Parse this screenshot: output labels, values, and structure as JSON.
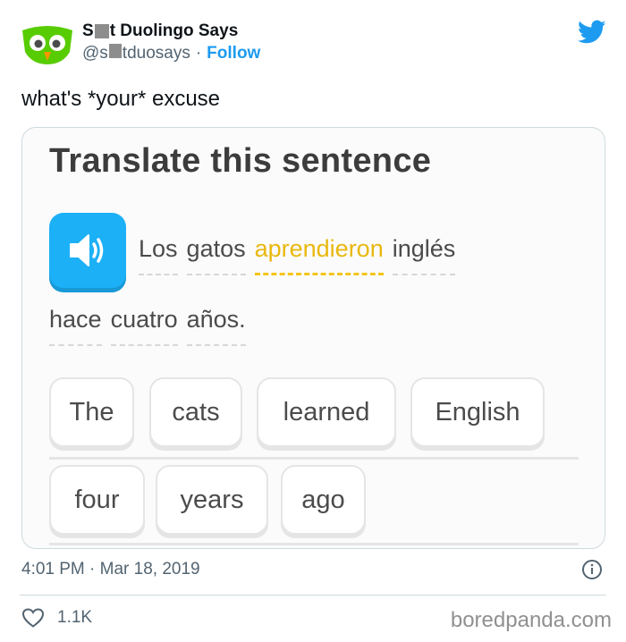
{
  "author": {
    "name_start": "S",
    "name_end": "t Duolingo Says",
    "handle_start": "@s",
    "handle_end": "tduosays",
    "follow_label": "Follow"
  },
  "tweet": {
    "text": "what's *your* excuse",
    "timestamp": "4:01 PM · Mar 18, 2019",
    "likes": "1.1K"
  },
  "card": {
    "title": "Translate this sentence",
    "sentence_words": [
      "Los",
      "gatos",
      "aprendieron",
      "inglés",
      "hace",
      "cuatro",
      "años."
    ],
    "highlighted_word": "aprendieron",
    "answer_chips": [
      "The",
      "cats",
      "learned",
      "English",
      "four",
      "years",
      "ago"
    ]
  },
  "watermark": "boredpanda.com",
  "colors": {
    "twitter_blue": "#1d9bf0",
    "duo_green": "#58cc02",
    "duo_speaker_blue": "#1cb0f6",
    "highlight_yellow": "#e9b80e"
  },
  "icons": [
    "owl-avatar-icon",
    "twitter-bird-icon",
    "speaker-icon",
    "info-icon",
    "heart-icon"
  ]
}
